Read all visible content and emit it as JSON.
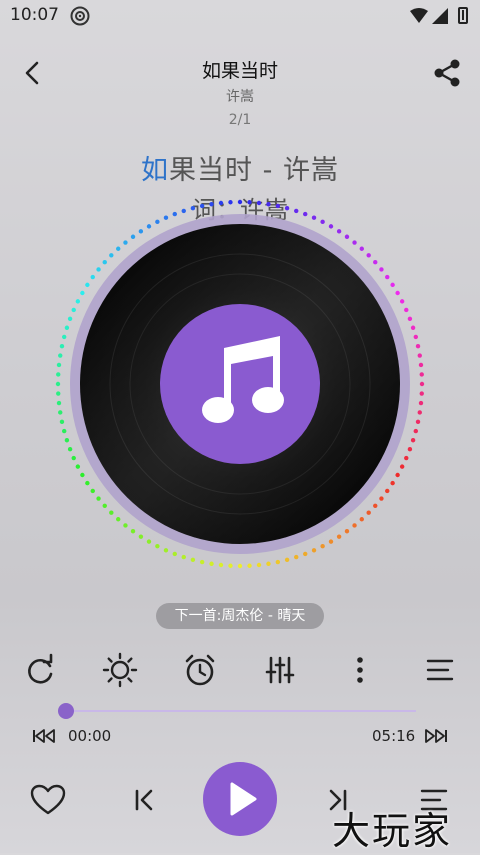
{
  "status_bar": {
    "time": "10:07"
  },
  "header": {
    "title": "如果当时",
    "artist": "许嵩",
    "pager": "2/1"
  },
  "lyrics": {
    "line1_highlight": "如",
    "line1_rest": "果当时 - 许嵩",
    "line2": "词：许嵩"
  },
  "next_track": "下一首:周杰伦 - 晴天",
  "progress": {
    "current": "00:00",
    "total": "05:16",
    "fraction": 0.0
  },
  "colors": {
    "accent": "#8a5bd0",
    "lyric_highlight": "#2e73c9"
  },
  "icons": {
    "back": "arrow-left",
    "share": "share",
    "repeat": "repeat",
    "brightness": "sun",
    "timer": "alarm-clock",
    "equalizer": "sliders",
    "more": "dots-vertical",
    "menu": "lines",
    "skip_back": "rewind",
    "skip_forward": "fast-forward",
    "favorite": "heart",
    "previous": "skip-previous",
    "play": "play",
    "next": "skip-next",
    "playlist": "playlist"
  },
  "watermark": "大玩家"
}
